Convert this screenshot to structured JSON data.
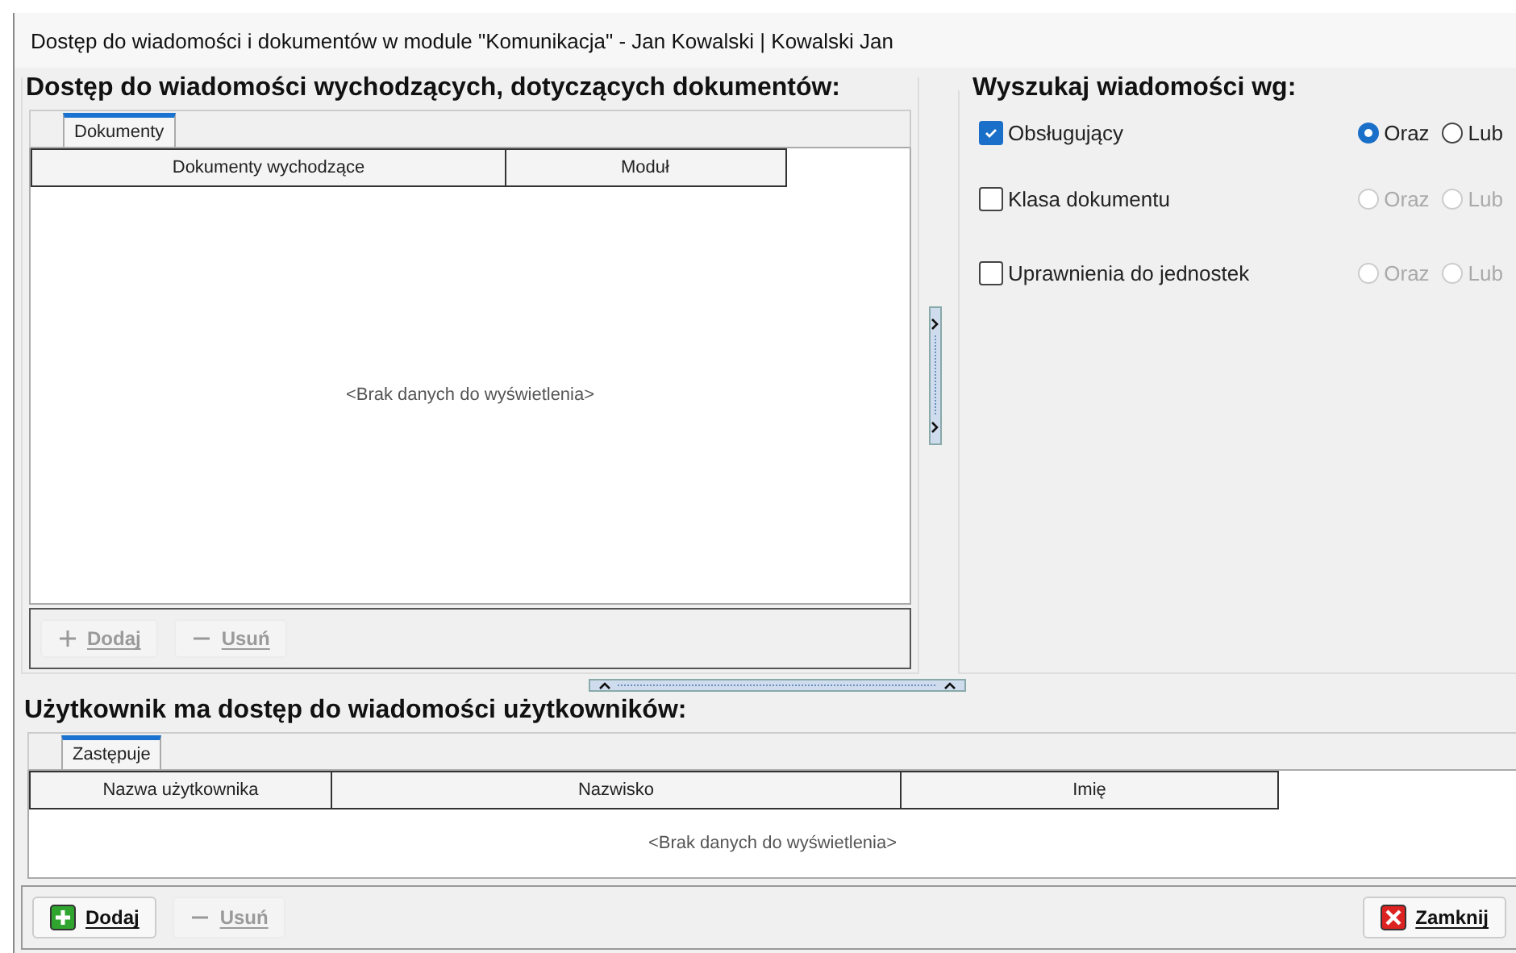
{
  "window": {
    "title": "Dostęp do wiadomości i dokumentów w module \"Komunikacja\" - Jan Kowalski | Kowalski Jan"
  },
  "outgoing": {
    "heading": "Dostęp do wiadomości wychodzących, dotyczących dokumentów:",
    "tabs": [
      {
        "label": "Dokumenty",
        "selected": true
      }
    ],
    "columns": [
      "Dokumenty wychodzące",
      "Moduł"
    ],
    "empty_text": "<Brak danych do wyświetlenia>",
    "buttons": [
      {
        "label": "Dodaj",
        "kind": "add",
        "disabled": true
      },
      {
        "label": "Usuń",
        "kind": "remove",
        "disabled": true
      }
    ]
  },
  "search": {
    "heading": "Wyszukaj wiadomości wg:",
    "criteria": [
      {
        "label": "Obsługujący",
        "checked": true,
        "options": [
          {
            "label": "Oraz",
            "selected": true,
            "disabled": false
          },
          {
            "label": "Lub",
            "selected": false,
            "disabled": false
          }
        ]
      },
      {
        "label": "Klasa dokumentu",
        "checked": false,
        "options": [
          {
            "label": "Oraz",
            "selected": false,
            "disabled": true
          },
          {
            "label": "Lub",
            "selected": false,
            "disabled": true
          }
        ]
      },
      {
        "label": "Uprawnienia do jednostek",
        "checked": false,
        "options": [
          {
            "label": "Oraz",
            "selected": false,
            "disabled": true
          },
          {
            "label": "Lub",
            "selected": false,
            "disabled": true
          }
        ]
      }
    ]
  },
  "users": {
    "heading": "Użytkownik ma dostęp do wiadomości użytkowników:",
    "tabs": [
      {
        "label": "Zastępuje",
        "selected": true
      }
    ],
    "columns": [
      "Nazwa użytkownika",
      "Nazwisko",
      "Imię"
    ],
    "empty_text": "<Brak danych do wyświetlenia>",
    "buttons": [
      {
        "label": "Dodaj",
        "kind": "add",
        "disabled": false
      },
      {
        "label": "Usuń",
        "kind": "remove",
        "disabled": true
      }
    ]
  },
  "close_button": {
    "label": "Zamknij"
  }
}
